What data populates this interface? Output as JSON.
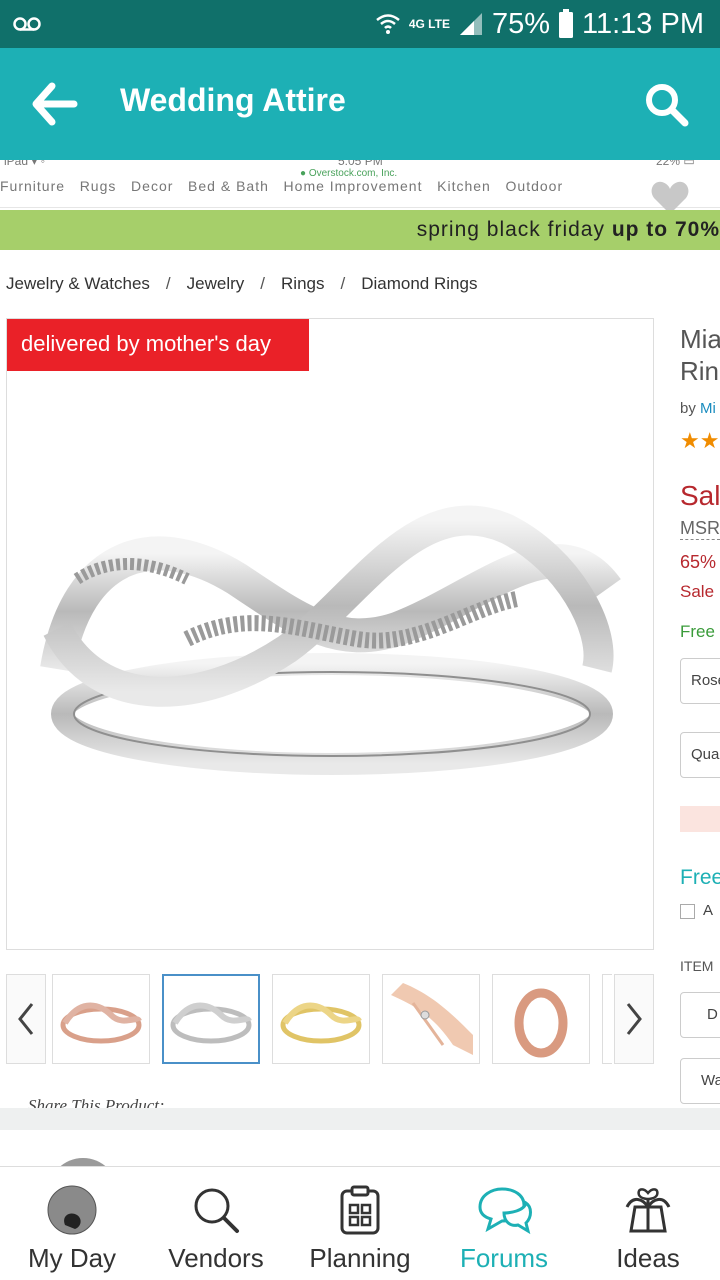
{
  "status_bar": {
    "network": "4G LTE",
    "battery": "75%",
    "time": "11:13 PM"
  },
  "app_bar": {
    "title": "Wedding Attire",
    "back_icon": "arrow-left-icon",
    "search_icon": "search-icon"
  },
  "embedded": {
    "url": "Overstock.com, Inc.",
    "promo": {
      "prefix": "spring black friday ",
      "bold": "up to 70%"
    },
    "breadcrumb": [
      "Jewelry & Watches",
      "Jewelry",
      "Rings",
      "Diamond Rings"
    ],
    "badge": "delivered by mother's day",
    "right_column": {
      "title_line1": "Mia",
      "title_line2": "Rin",
      "by_prefix": "by ",
      "by_link": "Mi",
      "sale": "Sal",
      "msrp": "MSR",
      "percent": "65%",
      "sale_note": "Sale",
      "free_shipping": "Free",
      "color_select": "Rose",
      "quantity_select": "Quar",
      "free2": "Free",
      "checkbox_label": "A",
      "item_label": "ITEM",
      "option1": "D",
      "option2": "Wa"
    },
    "share": "Share This Product:",
    "colors": {
      "promo": "#a6cf6a",
      "badge": "#ea2128",
      "sale": "#b7282e",
      "free": "#3a9b3a",
      "link": "#1a8cbf"
    }
  },
  "bottom_nav": {
    "items": [
      {
        "label": "My Day",
        "icon": "avatar-icon"
      },
      {
        "label": "Vendors",
        "icon": "search-icon"
      },
      {
        "label": "Planning",
        "icon": "clipboard-icon"
      },
      {
        "label": "Forums",
        "icon": "chat-bubbles-icon",
        "active": true
      },
      {
        "label": "Ideas",
        "icon": "gift-icon"
      }
    ]
  },
  "theme": {
    "teal": "#1db0b5",
    "status_bar": "#10706a"
  }
}
